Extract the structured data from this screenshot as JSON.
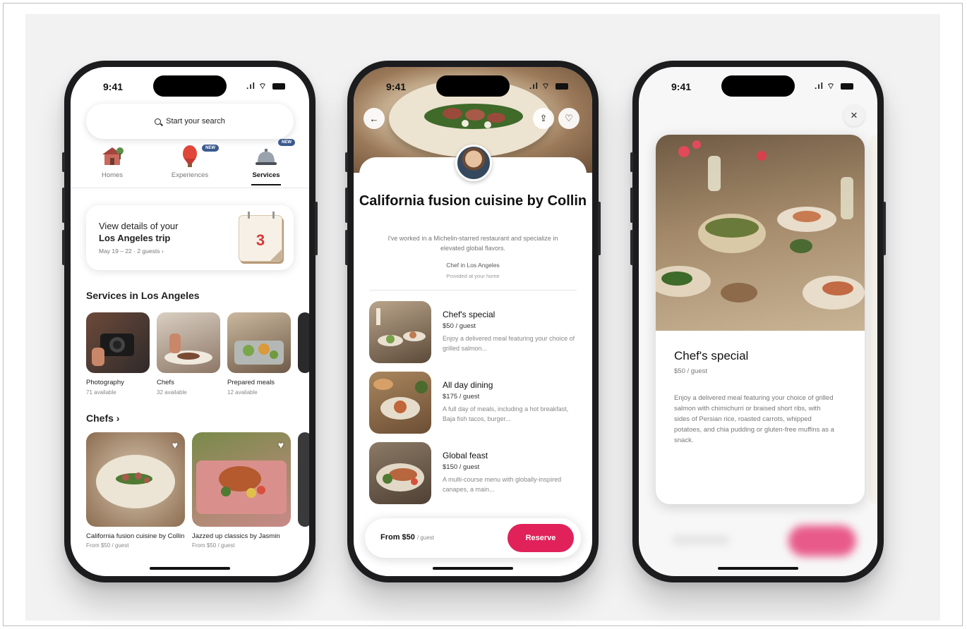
{
  "status": {
    "time": "9:41"
  },
  "phone1": {
    "search_placeholder": "Start your search",
    "categories": [
      {
        "label": "Homes",
        "icon": "house-icon",
        "badge": ""
      },
      {
        "label": "Experiences",
        "icon": "hot-air-balloon-icon",
        "badge": "NEW"
      },
      {
        "label": "Services",
        "icon": "service-bell-icon",
        "badge": "NEW"
      }
    ],
    "trip": {
      "line1": "View details of your",
      "line2": "Los Angeles trip",
      "line3": "May 19 – 22 · 2 guests ›",
      "calendar_day": "3"
    },
    "services_title": "Services in Los Angeles",
    "services": [
      {
        "name": "Photography",
        "sub": "71 available"
      },
      {
        "name": "Chefs",
        "sub": "32 available"
      },
      {
        "name": "Prepared meals",
        "sub": "12 available"
      }
    ],
    "chefs_title": "Chefs ›",
    "chefs": [
      {
        "name": "California fusion cuisine by Collin",
        "sub": "From $50 / guest"
      },
      {
        "name": "Jazzed up classics by Jasmin",
        "sub": "From $50 / guest"
      }
    ]
  },
  "phone2": {
    "title": "California fusion cuisine by Collin",
    "description": "I've worked in a Michelin-starred restaurant and specialize in elevated global flavors.",
    "role": "Chef in Los Angeles",
    "location": "Provided at your home",
    "menu": [
      {
        "name": "Chef's special",
        "price": "$50 / guest",
        "desc": "Enjoy a delivered meal featuring your choice of grilled salmon..."
      },
      {
        "name": "All day dining",
        "price": "$175 / guest",
        "desc": "A full day of meals, including a hot breakfast, Baja fish tacos, burger..."
      },
      {
        "name": "Global feast",
        "price": "$150 / guest",
        "desc": "A multi-course menu with globally-inspired canapes, a main..."
      }
    ],
    "from_price": "From $50",
    "from_unit": "/ guest",
    "reserve_label": "Reserve",
    "accent": "#e0215a"
  },
  "phone3": {
    "name": "Chef's special",
    "price": "$50 / guest",
    "description": "Enjoy a delivered meal featuring your choice of grilled salmon with chimichurri or braised short ribs, with sides of Persian rice, roasted carrots, whipped potatoes, and chia pudding or gluten-free muffins as a snack."
  }
}
